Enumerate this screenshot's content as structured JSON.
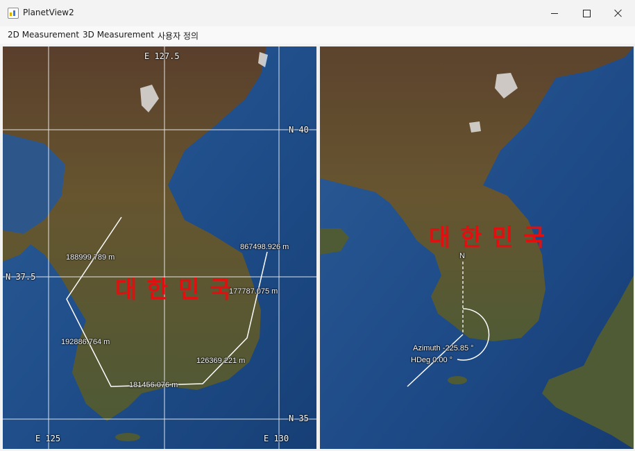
{
  "window": {
    "title": "PlanetView2",
    "icon": "app-icon"
  },
  "menu": {
    "items": [
      "2D Measurement",
      "3D Measurement",
      "사용자 정의"
    ]
  },
  "left_map": {
    "country_label": "대한민국",
    "grid_labels": {
      "top_lon": "E 127.5",
      "right_lat_top": "N 40",
      "left_lat_mid": "N 37.5",
      "right_lat_bottom": "N 35",
      "bottom_lon_left": "E 125",
      "bottom_lon_right": "E 130"
    },
    "measurements": [
      "188999.789 m",
      "867498.926 m",
      "177787.075 m",
      "192886.764 m",
      "126369.221 m",
      "181456.076 m"
    ],
    "colors": {
      "label": "#e01010",
      "sea": "#1d4a86",
      "land": "#6b5a35",
      "grid": "#ffffff"
    }
  },
  "right_map": {
    "country_label": "대한민국",
    "north_marker": "N",
    "azimuth": "Azimuth -225.85 °",
    "hdeg": "HDeg 0.00 °"
  }
}
